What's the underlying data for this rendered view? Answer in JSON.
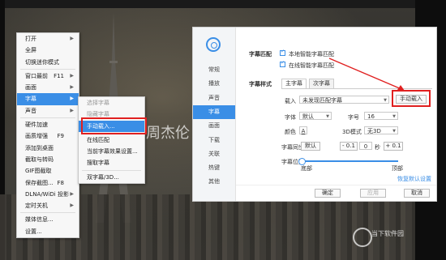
{
  "main_menu": [
    {
      "label": "打开",
      "shortcut": "",
      "arrow": true
    },
    {
      "label": "全屏",
      "shortcut": "",
      "arrow": false
    },
    {
      "label": "切换迷你模式",
      "shortcut": "",
      "arrow": false
    },
    {
      "label": "窗口最前",
      "shortcut": "F11",
      "arrow": true
    },
    {
      "label": "画面",
      "shortcut": "",
      "arrow": true
    },
    {
      "label": "字幕",
      "shortcut": "",
      "arrow": true,
      "active": true
    },
    {
      "label": "声音",
      "shortcut": "",
      "arrow": true
    },
    {
      "label": "硬件加速",
      "shortcut": "",
      "arrow": false
    },
    {
      "label": "画质增强",
      "shortcut": "F9",
      "arrow": false
    },
    {
      "label": "添加到桌面",
      "shortcut": "",
      "arrow": false
    },
    {
      "label": "截取与转码",
      "shortcut": "",
      "arrow": false
    },
    {
      "label": "GIF图截取",
      "shortcut": "",
      "arrow": false
    },
    {
      "label": "保存截图...",
      "shortcut": "F8",
      "arrow": false
    },
    {
      "label": "DLNA/WiDi 投影",
      "shortcut": "",
      "arrow": true
    },
    {
      "label": "定时关机",
      "shortcut": "",
      "arrow": true
    },
    {
      "label": "媒体信息...",
      "shortcut": "",
      "arrow": false
    },
    {
      "label": "设置...",
      "shortcut": "",
      "arrow": false
    }
  ],
  "sub_menu": [
    {
      "label": "选择字幕",
      "disabled": true
    },
    {
      "label": "隐藏字幕",
      "disabled": true
    },
    {
      "label": "手动载入...",
      "active": true
    },
    {
      "label": "在线匹配"
    },
    {
      "label": "当前字幕效果设置..."
    },
    {
      "label": "搜取字幕"
    },
    {
      "label": "双字幕/3D..."
    }
  ],
  "dialog": {
    "nav": [
      "常规",
      "播放",
      "声音",
      "字幕",
      "画面",
      "下载",
      "关联",
      "热键",
      "其他"
    ],
    "active_nav": "字幕",
    "match_label": "字幕匹配",
    "match_local": "本地智能字幕匹配",
    "match_online": "在线智能字幕匹配",
    "style_label": "字幕样式",
    "tab_main": "主字幕",
    "tab_secondary": "次字幕",
    "load_label": "载入",
    "load_value": "未发现匹配字幕",
    "manual_load_button": "手动载入",
    "font_label": "字体",
    "font_value": "默认",
    "size_label": "字号",
    "size_value": "16",
    "color_label": "颜色",
    "color_glyph": "A",
    "mode3d_label": "3D模式",
    "mode3d_value": "无3D",
    "sync_label": "字幕同步",
    "sync_default": "默认",
    "sync_minus": "- 0.1",
    "sync_value": "0",
    "sync_unit": "秒",
    "sync_plus": "+ 0.1",
    "position_label": "字幕位置",
    "position_bottom": "底部",
    "position_top": "顶部",
    "restore_link": "恢复默认设置",
    "ok": "确定",
    "apply": "应用",
    "cancel": "取消"
  },
  "overlay": {
    "title_text": "周杰伦",
    "watermark": "当下软件园"
  },
  "colors": {
    "accent": "#3a8ee6",
    "highlight": "#e02020"
  }
}
